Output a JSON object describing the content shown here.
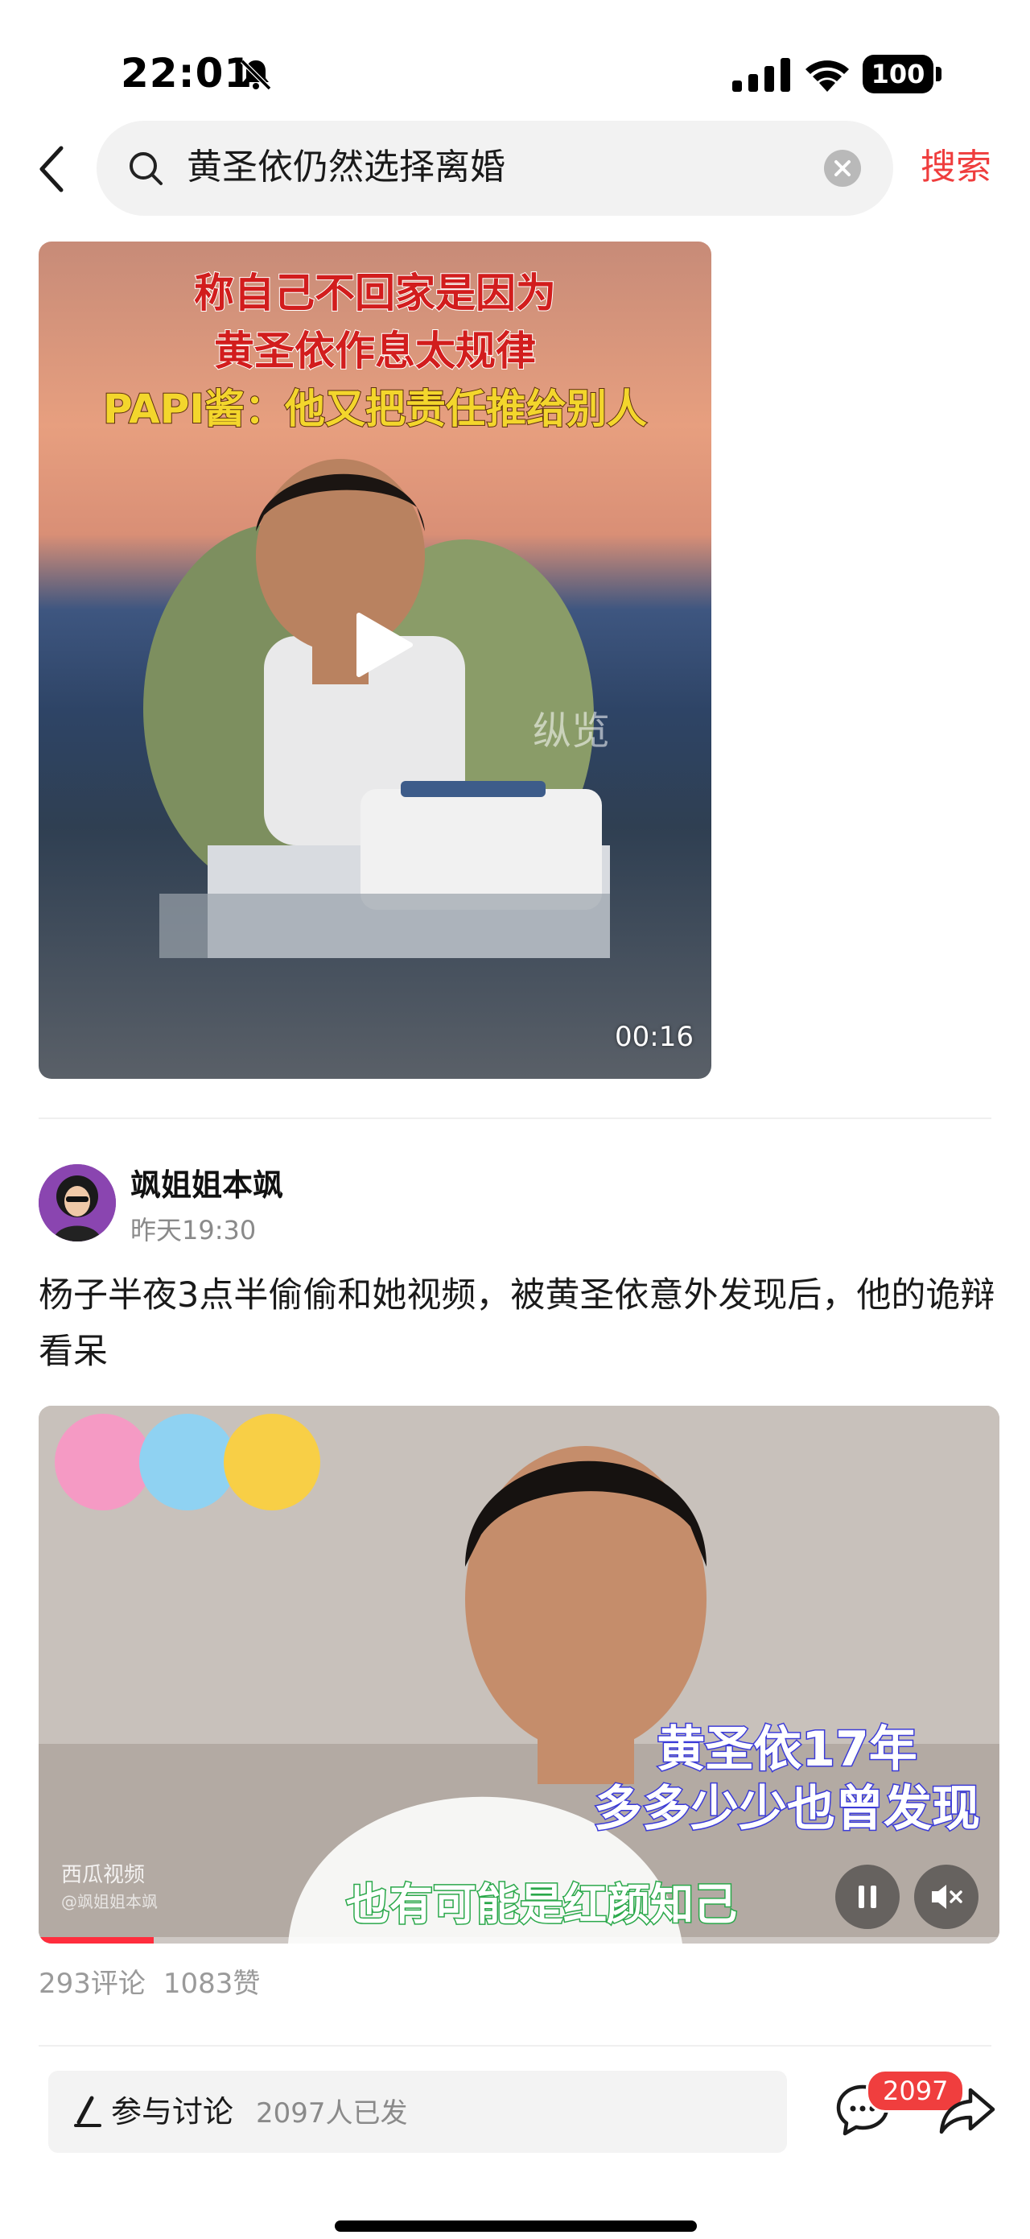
{
  "status_bar": {
    "time": "22:01",
    "battery": "100"
  },
  "search": {
    "query": "黄圣依仍然选择离婚",
    "action_label": "搜索"
  },
  "video1": {
    "overlay_lines": [
      "称自己不回家是因为",
      "黄圣依作息太规律",
      "PAPI酱：他又把责任推给别人"
    ],
    "watermark": "纵览",
    "duration": "00:16"
  },
  "post": {
    "author": "飒姐姐本飒",
    "time": "昨天19:30",
    "text": "杨子半夜3点半偷偷和她视频，被黄圣依意外发现后，他的诡辩看呆",
    "video": {
      "caption_top": [
        "黄圣依17年",
        "多多少少也曾发现"
      ],
      "caption_bottom": "也有可能是红颜知己",
      "logo": "西瓜视频",
      "logo_sub": "@飒姐姐本飒",
      "progress": 0.12
    },
    "comments": "293评论",
    "likes": "1083赞"
  },
  "bottom_bar": {
    "discuss_label": "参与讨论",
    "discuss_count": "2097人已发",
    "comment_badge": "2097"
  },
  "colors": {
    "accent": "#ef3d3d",
    "badge": "#f03e3e"
  }
}
